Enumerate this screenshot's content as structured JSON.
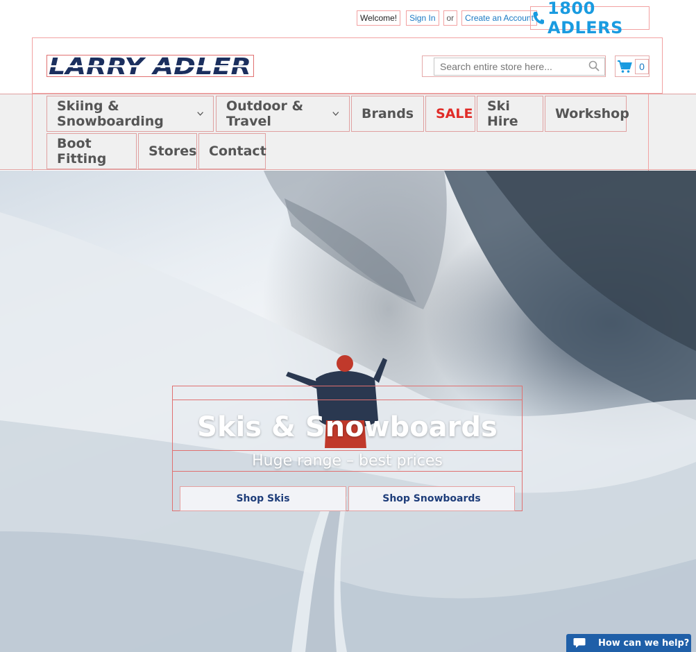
{
  "top_links": {
    "welcome": "Welcome!",
    "sign_in": "Sign In",
    "or": "or",
    "create_account": "Create an Account"
  },
  "phone": {
    "icon": "phone-icon",
    "number": "1800 ADLERS"
  },
  "header": {
    "logo_text": "LARRY ADLER",
    "search_placeholder": "Search entire store here...",
    "cart_count": "0"
  },
  "nav": {
    "items": [
      {
        "label": "Skiing & Snowboarding",
        "has_dropdown": true
      },
      {
        "label": "Outdoor & Travel",
        "has_dropdown": true
      },
      {
        "label": "Brands",
        "has_dropdown": true
      },
      {
        "label": "SALE",
        "has_dropdown": false
      },
      {
        "label": "Ski Hire",
        "has_dropdown": false
      },
      {
        "label": "Workshop",
        "has_dropdown": false
      },
      {
        "label": "Boot Fitting",
        "has_dropdown": false
      },
      {
        "label": "Stores",
        "has_dropdown": false
      },
      {
        "label": "Contact",
        "has_dropdown": false
      }
    ]
  },
  "hero": {
    "title": "Skis & Snowboards",
    "subtitle": "Huge range – best prices",
    "buttons": [
      {
        "label": "Shop Skis"
      },
      {
        "label": "Shop Snowboards"
      }
    ]
  },
  "chat": {
    "label": "How can we help?"
  },
  "colors": {
    "link_blue": "#1979c3",
    "phone_blue": "#1a9be0",
    "logo_navy": "#1b2f5e",
    "sale_red": "#e02b27",
    "nav_bg": "#f0f0f0",
    "chat_bg": "#1f5fa8"
  }
}
